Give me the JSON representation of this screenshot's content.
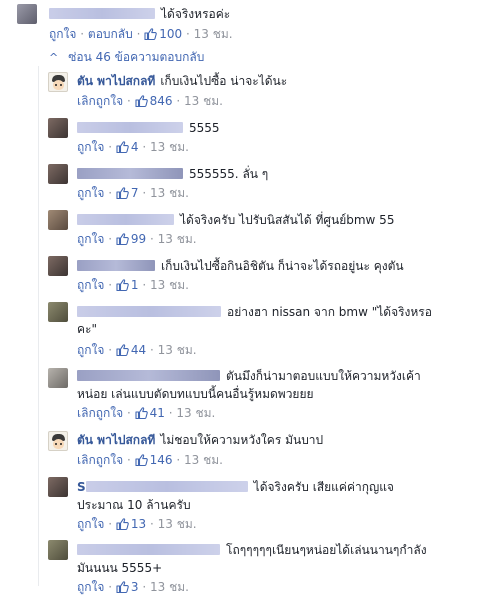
{
  "top_comment": {
    "text": "ได้จริงหรอค่ะ",
    "like_label": "ถูกใจ",
    "reply_label": "ตอบกลับ",
    "likes": "100",
    "time": "13 ชม."
  },
  "replies_toggle": {
    "chevron": "^",
    "label": "ซ่อน 46 ข้อความตอบกลับ"
  },
  "replies": [
    {
      "name": "ตัน พาไปสกลที",
      "text": "เก็บเงินไปซื้อ น่าจะได้นะ",
      "like_label": "เลิกถูกใจ",
      "likes": "846",
      "time": "13 ชม."
    },
    {
      "name": "",
      "text": "5555",
      "like_label": "ถูกใจ",
      "likes": "4",
      "time": "13 ชม."
    },
    {
      "name": "",
      "text": "555555. ลั่น ๆ",
      "like_label": "ถูกใจ",
      "likes": "7",
      "time": "13 ชม."
    },
    {
      "name": "",
      "text": "ได้จริงครับ ไปรับนิสสันได้ ที่ศูนย์bmw 55",
      "like_label": "ถูกใจ",
      "likes": "99",
      "time": "13 ชม."
    },
    {
      "name": "",
      "text": "เก็บเงินไปซื้อกินอิชิตัน ก็น่าจะได้รถอยู่นะ คุงตัน",
      "like_label": "ถูกใจ",
      "likes": "1",
      "time": "13 ชม."
    },
    {
      "name": "",
      "text_line1": "อย่างฮา nissan จาก bmw \"ได้จริงหรอ",
      "text_line2": "คะ\"",
      "like_label": "ถูกใจ",
      "likes": "44",
      "time": "13 ชม."
    },
    {
      "name": "",
      "text_line1": "ตันมึงก็น่ามาตอบแบบให้ความหวังเค้า",
      "text_line2": "หน่อย เล่นแบบตัดบทแบบนี้คนอื่นรู้หมดพวยยย",
      "like_label": "เลิกถูกใจ",
      "likes": "41",
      "time": "13 ชม."
    },
    {
      "name": "ตัน พาไปสกลที",
      "text": "ไม่ชอบให้ความหวังใคร มันบาป",
      "like_label": "เลิกถูกใจ",
      "likes": "146",
      "time": "13 ชม."
    },
    {
      "name": "S",
      "text_line1": "ได้จริงครับ เสียแค่ค่ากุญแจ",
      "text_line2": "ประมาณ 10 ล้านครับ",
      "like_label": "ถูกใจ",
      "likes": "13",
      "time": "13 ชม."
    },
    {
      "name": "",
      "text_line1": "โถๆๆๆๆๆเนียนๆหน่อยได้เล่นนานๆกำลัง",
      "text_line2": "มันนนน 5555+",
      "like_label": "ถูกใจ",
      "likes": "3",
      "time": "13 ชม."
    }
  ],
  "separator": "·",
  "icons": {
    "thumb": "thumbs-up-icon",
    "avatar_cartoon": "cartoon-avatar-icon"
  },
  "colors": {
    "link": "#4267b2",
    "name": "#365899",
    "meta": "#90949c",
    "text": "#1d2129"
  }
}
